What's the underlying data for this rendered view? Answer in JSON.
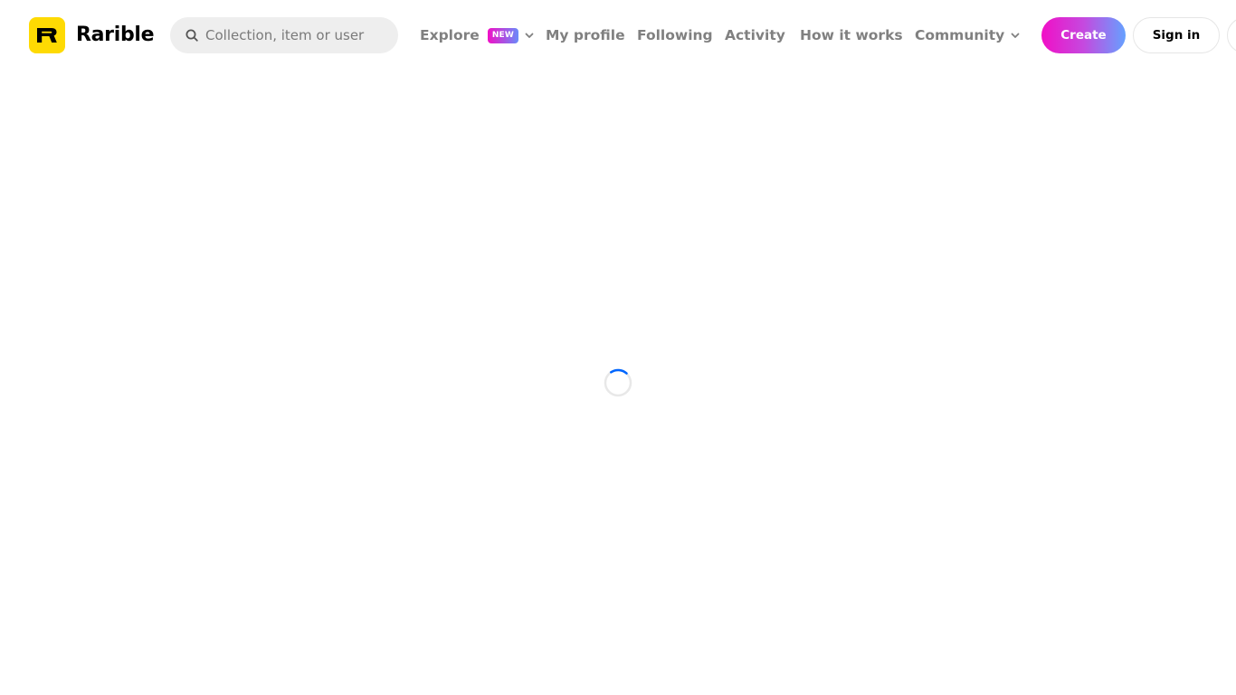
{
  "app": {
    "brand": "Rarible",
    "logo_letter": "R",
    "brand_color": "#FEDA03"
  },
  "search": {
    "placeholder": "Collection, item or user",
    "value": "",
    "icon": "search-icon"
  },
  "nav": {
    "items": [
      {
        "label": "Explore",
        "badge": "NEW",
        "has_dropdown": true
      },
      {
        "label": "My profile"
      },
      {
        "label": "Following"
      },
      {
        "label": "Activity"
      },
      {
        "label": "How it works"
      },
      {
        "label": "Community",
        "has_dropdown": true
      }
    ]
  },
  "actions": {
    "create_label": "Create",
    "signin_label": "Sign in"
  },
  "colors": {
    "nav_text": "#808080",
    "gradient_start": "#F10FC6",
    "gradient_end": "#65A1FF",
    "spinner_accent": "#0066FF"
  },
  "main": {
    "state": "loading",
    "spinner_icon": "loading-spinner-icon"
  }
}
